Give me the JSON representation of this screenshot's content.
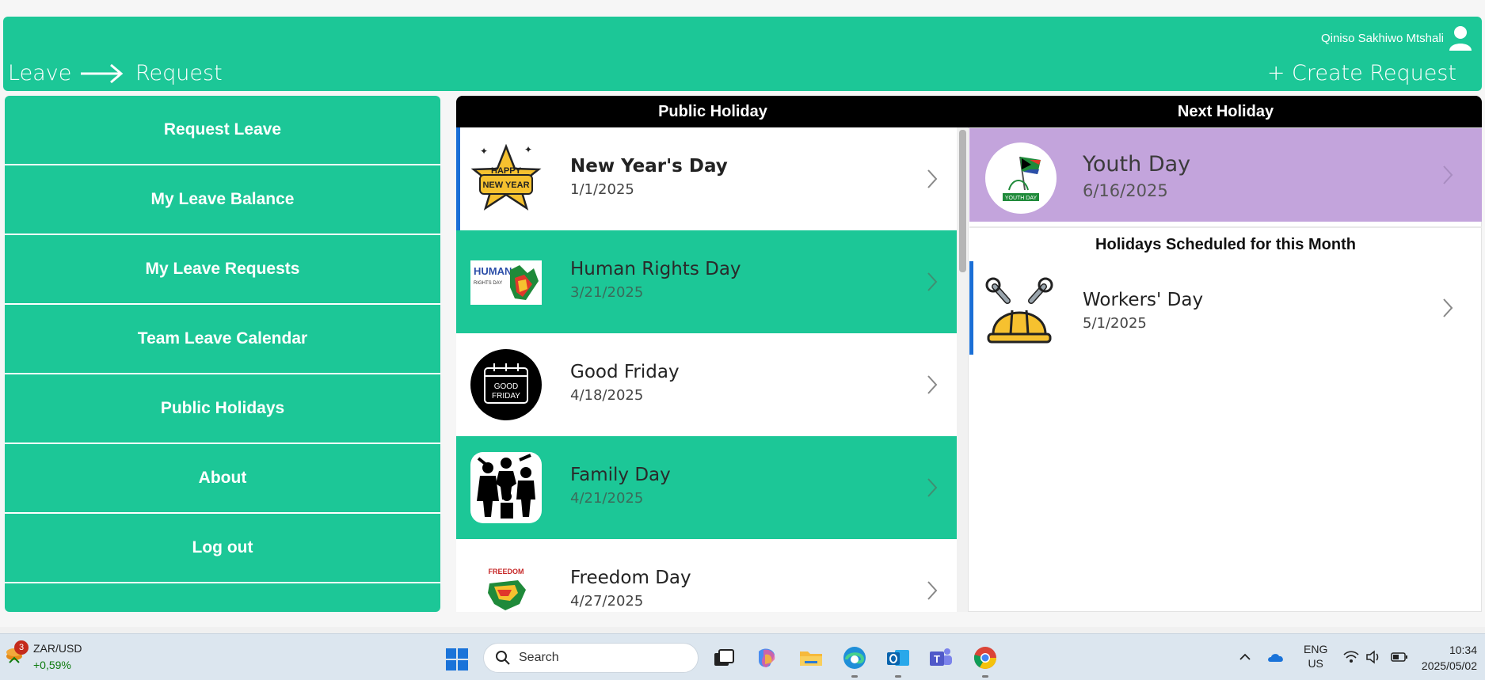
{
  "header": {
    "user_name": "Qiniso Sakhiwo Mtshali",
    "breadcrumb_leave": "Leave",
    "breadcrumb_request": "Request",
    "create_request": "+ Create Request"
  },
  "sidebar": {
    "items": [
      {
        "label": "Request Leave"
      },
      {
        "label": "My Leave Balance"
      },
      {
        "label": "My Leave Requests"
      },
      {
        "label": "Team Leave Calendar"
      },
      {
        "label": "Public Holidays"
      },
      {
        "label": "About"
      },
      {
        "label": "Log out"
      }
    ]
  },
  "public_holidays": {
    "header": "Public Holiday",
    "items": [
      {
        "title": "New Year's Day",
        "date": "1/1/2025",
        "icon": "happy-new-year-star-icon",
        "badge_line1": "HAPPY",
        "badge_line2": "NEW YEAR"
      },
      {
        "title": "Human Rights Day",
        "date": "3/21/2025",
        "icon": "human-rights-day-icon",
        "badge_line1": "HUMAN",
        "badge_line2": "RIGHTS DAY"
      },
      {
        "title": "Good Friday",
        "date": "4/18/2025",
        "icon": "good-friday-calendar-icon",
        "badge_line1": "GOOD",
        "badge_line2": "FRIDAY"
      },
      {
        "title": "Family Day",
        "date": "4/21/2025",
        "icon": "family-silhouette-icon"
      },
      {
        "title": "Freedom Day",
        "date": "4/27/2025",
        "icon": "freedom-day-map-icon",
        "badge_line1": "FREEDOM"
      }
    ]
  },
  "next_holiday": {
    "header": "Next Holiday",
    "title": "Youth Day",
    "date": "6/16/2025",
    "logo_text": "YOUTH DAY"
  },
  "this_month": {
    "title": "Holidays Scheduled for this Month",
    "items": [
      {
        "title": "Workers' Day",
        "date": "5/1/2025",
        "icon": "hard-hat-wrenches-icon"
      }
    ]
  },
  "taskbar": {
    "widget_badge": "3",
    "ticker": "ZAR/USD",
    "ticker_change": "+0,59%",
    "search_placeholder": "Search",
    "language_line1": "ENG",
    "language_line2": "US",
    "time": "10:34",
    "date": "2025/05/02"
  },
  "colors": {
    "brand_green": "#1cc797",
    "next_holiday_purple": "#c3a4dc",
    "selection_blue": "#1a6fd6",
    "header_black": "#000000"
  }
}
